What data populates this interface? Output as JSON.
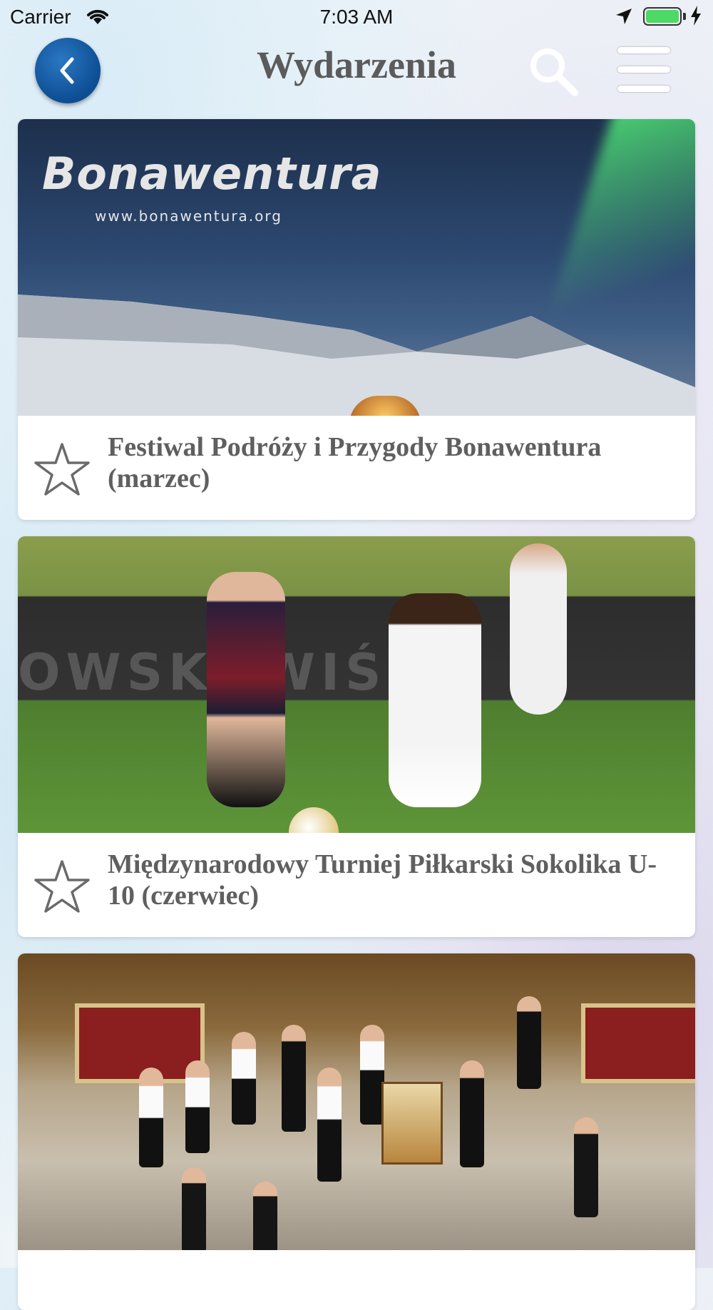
{
  "status_bar": {
    "carrier": "Carrier",
    "time": "7:03 AM",
    "battery_level": 1.0
  },
  "nav": {
    "title": "Wydarzenia",
    "back_icon": "chevron-left-icon",
    "search_icon": "search-icon",
    "menu_icon": "hamburger-menu-icon"
  },
  "colors": {
    "back_button": "#0d4d93",
    "title": "#5b5b5b",
    "card_title": "#5f5f5f"
  },
  "events": [
    {
      "title": "Festiwal Podróży i Przygody Bonawentura (marzec)",
      "image_text": "Bonawentura",
      "image_subtext": "www.bonawentura.org",
      "favorite": false
    },
    {
      "title": "Międzynarodowy Turniej Piłkarski Sokolika U-10 (czerwiec)",
      "image_text": "OWSKI  WIŚNI",
      "favorite": false
    },
    {
      "title": "",
      "favorite": false
    }
  ]
}
